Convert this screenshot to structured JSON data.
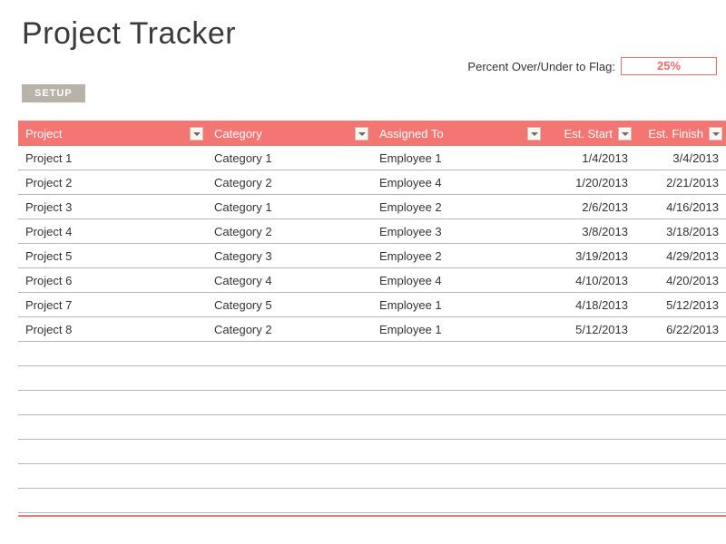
{
  "title": "Project Tracker",
  "flag": {
    "label": "Percent Over/Under to Flag:",
    "value": "25%"
  },
  "buttons": {
    "setup": "SETUP"
  },
  "columns": [
    {
      "key": "project",
      "label": "Project",
      "align": "left"
    },
    {
      "key": "category",
      "label": "Category",
      "align": "left"
    },
    {
      "key": "assigned",
      "label": "Assigned To",
      "align": "left"
    },
    {
      "key": "start",
      "label": "Est. Start",
      "align": "right"
    },
    {
      "key": "finish",
      "label": "Est. Finish",
      "align": "right"
    }
  ],
  "rows": [
    {
      "project": "Project 1",
      "category": "Category 1",
      "assigned": "Employee 1",
      "start": "1/4/2013",
      "finish": "3/4/2013"
    },
    {
      "project": "Project 2",
      "category": "Category 2",
      "assigned": "Employee 4",
      "start": "1/20/2013",
      "finish": "2/21/2013"
    },
    {
      "project": "Project 3",
      "category": "Category 1",
      "assigned": "Employee 2",
      "start": "2/6/2013",
      "finish": "4/16/2013"
    },
    {
      "project": "Project 4",
      "category": "Category 2",
      "assigned": "Employee 3",
      "start": "3/8/2013",
      "finish": "3/18/2013"
    },
    {
      "project": "Project 5",
      "category": "Category 3",
      "assigned": "Employee 2",
      "start": "3/19/2013",
      "finish": "4/29/2013"
    },
    {
      "project": "Project 6",
      "category": "Category 4",
      "assigned": "Employee 4",
      "start": "4/10/2013",
      "finish": "4/20/2013"
    },
    {
      "project": "Project 7",
      "category": "Category 5",
      "assigned": "Employee 1",
      "start": "4/18/2013",
      "finish": "5/12/2013"
    },
    {
      "project": "Project 8",
      "category": "Category 2",
      "assigned": "Employee 1",
      "start": "5/12/2013",
      "finish": "6/22/2013"
    }
  ],
  "empty_row_count": 7,
  "colors": {
    "accent": "#f37673",
    "setup_button": "#b8b2a8"
  }
}
